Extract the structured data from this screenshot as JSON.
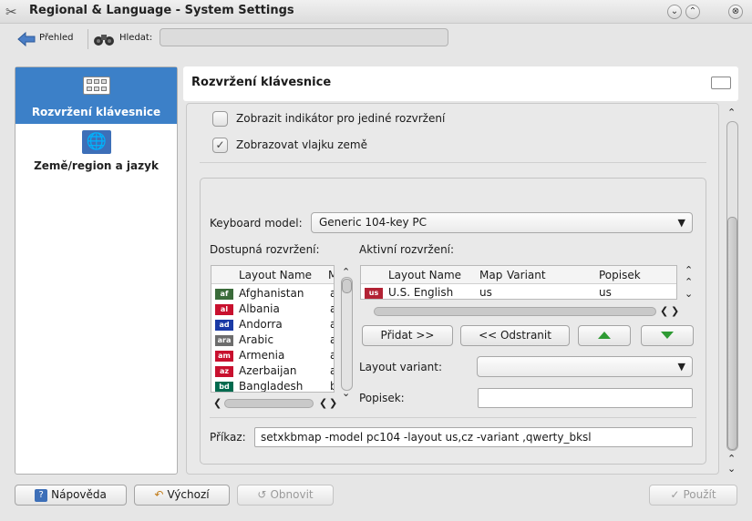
{
  "window": {
    "title": "Regional & Language - System Settings",
    "minimize_glyph": "⌄",
    "maximize_glyph": "⌃",
    "close_glyph": "⊗"
  },
  "toolbar": {
    "overview_label": "Přehled",
    "search_label": "Hledat:",
    "search_value": ""
  },
  "sidebar": {
    "items": [
      {
        "label": "Rozvržení klávesnice",
        "icon": "keyboard-icon",
        "selected": true
      },
      {
        "label": "Země/region a jazyk",
        "icon": "united-nations-flag-icon",
        "selected": false
      }
    ]
  },
  "header": {
    "title": "Rozvržení klávesnice"
  },
  "options": {
    "show_indicator_label": "Zobrazit indikátor pro jediné rozvržení",
    "show_indicator_checked": false,
    "show_flag_label": "Zobrazovat vlajku země",
    "show_flag_checked": true
  },
  "keyboard": {
    "model_label": "Keyboard model:",
    "model_value": "Generic 104-key PC",
    "available_label": "Dostupná rozvržení:",
    "active_label": "Aktivní rozvržení:",
    "available_columns": [
      "Layout Name",
      "M"
    ],
    "available_rows": [
      {
        "flag": "af",
        "name": "Afghanistan",
        "m": "a",
        "color": "#3a6b3a"
      },
      {
        "flag": "al",
        "name": "Albania",
        "m": "a",
        "color": "#c8102e"
      },
      {
        "flag": "ad",
        "name": "Andorra",
        "m": "a",
        "color": "#1a3aa6"
      },
      {
        "flag": "ara",
        "name": "Arabic",
        "m": "a",
        "color": "#6d6d6d"
      },
      {
        "flag": "am",
        "name": "Armenia",
        "m": "a",
        "color": "#c8102e"
      },
      {
        "flag": "az",
        "name": "Azerbaijan",
        "m": "a",
        "color": "#c8102e"
      },
      {
        "flag": "bd",
        "name": "Bangladesh",
        "m": "b",
        "color": "#006a4e"
      }
    ],
    "active_columns": [
      "Layout Name",
      "Map",
      "Variant",
      "Popisek"
    ],
    "active_rows": [
      {
        "flag": "us",
        "name": "U.S. English",
        "map": "us",
        "variant": "",
        "label": "us"
      }
    ],
    "add_button": "Přidat >>",
    "remove_button": "<< Odstranit",
    "variant_label": "Layout variant:",
    "variant_value": "",
    "popisek_label": "Popisek:",
    "popisek_value": "",
    "command_label": "Příkaz:",
    "command_value": "setxkbmap -model pc104 -layout us,cz -variant ,qwerty_bksl"
  },
  "footer": {
    "help_button": "Nápověda",
    "defaults_button": "Výchozí",
    "reset_button": "Obnovit",
    "apply_button": "Použít"
  },
  "colors": {
    "selection": "#3c80c8",
    "move_arrow": "#2e9a33"
  }
}
